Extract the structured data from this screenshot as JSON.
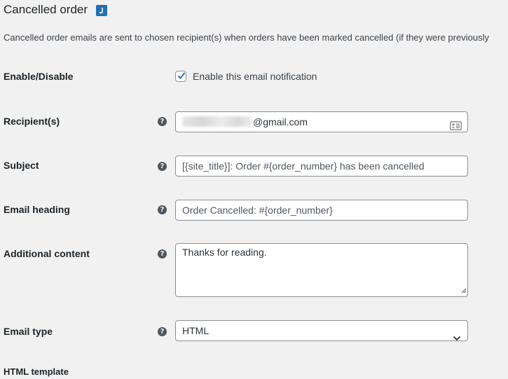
{
  "header": {
    "title": "Cancelled order",
    "description": "Cancelled order emails are sent to chosen recipient(s) when orders have been marked cancelled (if they were previously"
  },
  "enable": {
    "label": "Enable/Disable",
    "checkbox_label": "Enable this email notification",
    "checked": true
  },
  "recipient": {
    "label": "Recipient(s)",
    "value_suffix": "@gmail.com"
  },
  "subject": {
    "label": "Subject",
    "placeholder": "[{site_title}]: Order #{order_number} has been cancelled"
  },
  "heading": {
    "label": "Email heading",
    "placeholder": "Order Cancelled: #{order_number}"
  },
  "additional": {
    "label": "Additional content",
    "value": "Thanks for reading."
  },
  "email_type": {
    "label": "Email type",
    "selected": "HTML"
  },
  "template": {
    "label": "HTML template"
  },
  "colors": {
    "accent": "#2271b1",
    "background": "#f1f1f1"
  }
}
